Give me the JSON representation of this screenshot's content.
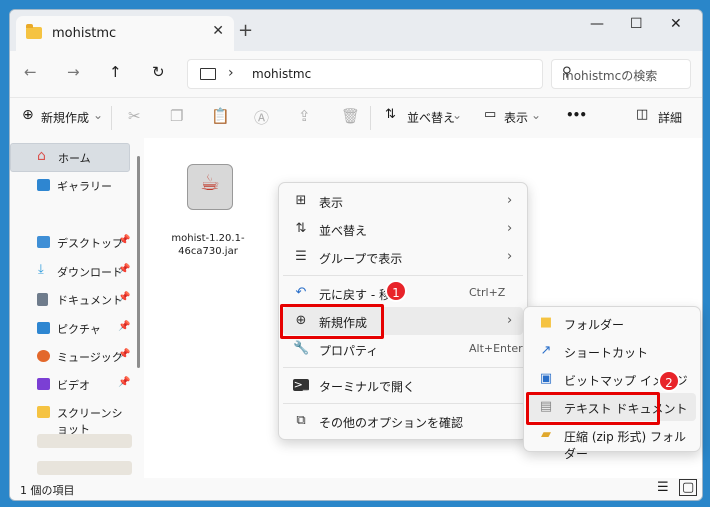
{
  "tab": {
    "title": "mohistmc",
    "close": "✕",
    "new": "+"
  },
  "window_controls": {
    "minimize": "—",
    "maximize": "☐",
    "close": "✕"
  },
  "address": {
    "path": "mohistmc",
    "search_placeholder": "mohistmcの検索"
  },
  "toolbar": {
    "new": "新規作成",
    "sort": "並べ替え",
    "view": "表示",
    "more": "•••",
    "details": "詳細"
  },
  "sidebar": {
    "home": "ホーム",
    "gallery": "ギャラリー",
    "items": [
      {
        "label": "デスクトップ",
        "color": "#3f8fd6"
      },
      {
        "label": "ダウンロード",
        "color": "#2d9bdc"
      },
      {
        "label": "ドキュメント",
        "color": "#6f7c8c"
      },
      {
        "label": "ピクチャ",
        "color": "#2e86d1"
      },
      {
        "label": "ミュージック",
        "color": "#e3682b"
      },
      {
        "label": "ビデオ",
        "color": "#7b3fd4"
      },
      {
        "label": "スクリーンショット",
        "color": "#f5c342"
      }
    ]
  },
  "file": {
    "name": "mohist-1.20.1-46ca730.jar"
  },
  "status": {
    "count": "1 個の項目"
  },
  "context_menu": {
    "view": "表示",
    "sort": "並べ替え",
    "group": "グループで表示",
    "undo": "元に戻す - 移動",
    "undo_shortcut": "Ctrl+Z",
    "new": "新規作成",
    "properties": "プロパティ",
    "properties_shortcut": "Alt+Enter",
    "terminal": "ターミナルで開く",
    "more_options": "その他のオプションを確認"
  },
  "submenu": {
    "folder": "フォルダー",
    "shortcut": "ショートカット",
    "bitmap": "ビットマップ イメージ",
    "text": "テキスト ドキュメント",
    "zip": "圧縮 (zip 形式) フォルダー"
  },
  "badges": {
    "one": "1",
    "two": "2"
  },
  "colors": {
    "accent": "#0067c0",
    "highlight": "#e60000",
    "badge": "#e8242a",
    "desktop_bg": "#2a86c9"
  }
}
